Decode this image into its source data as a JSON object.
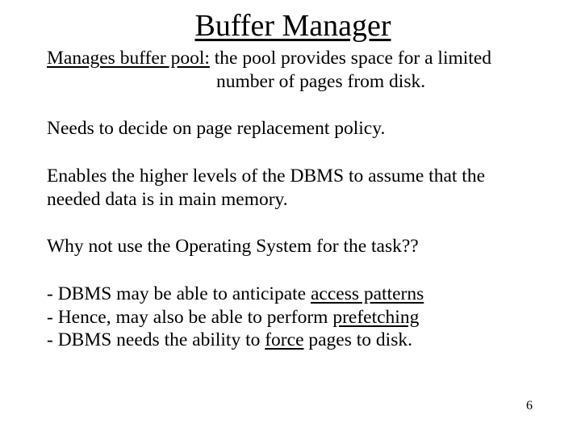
{
  "title": "Buffer Manager",
  "line1": {
    "lead_underlined": "Manages buffer pool:",
    "rest_l1": " the pool provides space for a limited",
    "rest_l2": "number of pages from disk."
  },
  "line2": "Needs to decide on page replacement policy.",
  "line3": "Enables the higher levels of the DBMS to assume that the needed data is in main memory.",
  "line4": "Why not use the Operating System for the task??",
  "bullets": {
    "b1a": "- DBMS may be able to anticipate ",
    "b1b": "access patterns",
    "b2a": "- Hence, may also be able to perform ",
    "b2b": "prefetching",
    "b3a": "- DBMS needs the ability to ",
    "b3b": "force",
    "b3c": " pages to disk."
  },
  "page_number": "6"
}
